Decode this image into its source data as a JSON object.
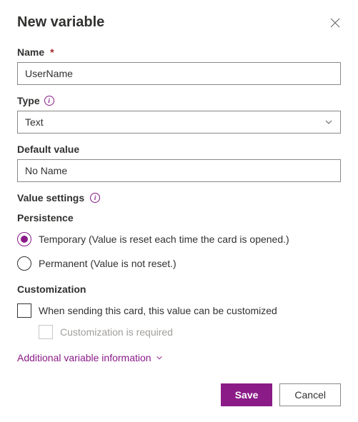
{
  "dialog": {
    "title": "New variable"
  },
  "fields": {
    "name": {
      "label": "Name",
      "required": "*",
      "value": "UserName"
    },
    "type": {
      "label": "Type",
      "value": "Text"
    },
    "defaultValue": {
      "label": "Default value",
      "value": "No Name"
    }
  },
  "valueSettings": {
    "label": "Value settings"
  },
  "persistence": {
    "label": "Persistence",
    "options": {
      "temporary": "Temporary (Value is reset each time the card is opened.)",
      "permanent": "Permanent (Value is not reset.)"
    }
  },
  "customization": {
    "label": "Customization",
    "whenSending": "When sending this card, this value can be customized",
    "required": "Customization is required"
  },
  "additionalInfo": {
    "label": "Additional variable information"
  },
  "buttons": {
    "save": "Save",
    "cancel": "Cancel"
  }
}
